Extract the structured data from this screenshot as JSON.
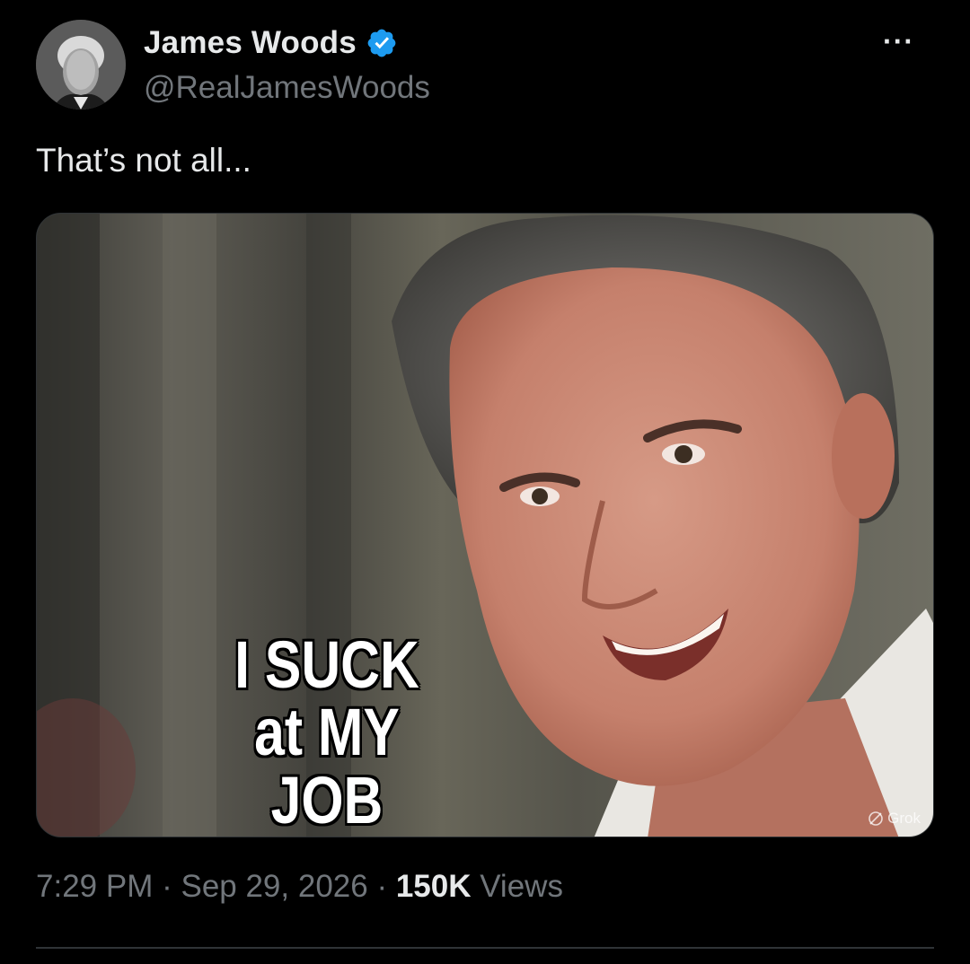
{
  "author": {
    "display_name": "James Woods",
    "handle": "@RealJamesWoods",
    "verified": true,
    "avatar_icon": "avatar-photo"
  },
  "more_label": "···",
  "tweet": {
    "text": "That’s not all..."
  },
  "media": {
    "caption_line1": "I SUCK",
    "caption_line2": "at MY JOB",
    "badge_label": "Grok"
  },
  "meta": {
    "time": "7:29 PM",
    "separator": " · ",
    "date": "Sep 29, 2026",
    "views_count": "150K",
    "views_label": " Views"
  },
  "colors": {
    "background": "#000000",
    "primary_text": "#e7e9ea",
    "secondary_text": "#71767b",
    "verified_blue": "#1d9bf0",
    "divider": "#2f3336"
  }
}
